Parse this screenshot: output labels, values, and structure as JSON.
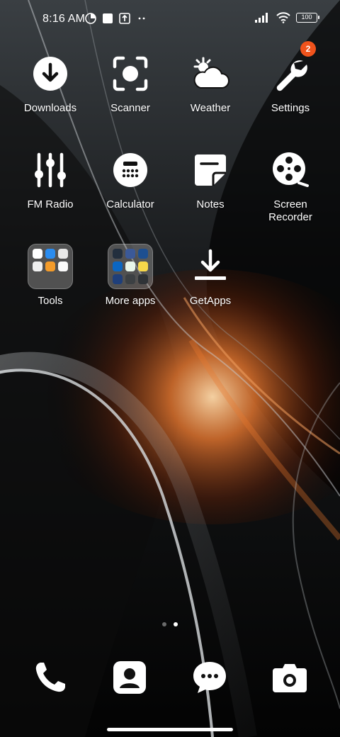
{
  "status_bar": {
    "time": "8:16 AM",
    "battery": "100",
    "icons_left": [
      "data-saver-icon",
      "square-notification-icon",
      "upload-notification-icon",
      "more-dots-icon"
    ],
    "icons_right": [
      "signal-icon",
      "wifi-icon",
      "battery-icon"
    ]
  },
  "apps": [
    {
      "label": "Downloads",
      "icon": "download-icon"
    },
    {
      "label": "Scanner",
      "icon": "scanner-icon"
    },
    {
      "label": "Weather",
      "icon": "weather-icon"
    },
    {
      "label": "Settings",
      "icon": "wrench-icon",
      "badge": "2"
    },
    {
      "label": "FM Radio",
      "icon": "sliders-icon"
    },
    {
      "label": "Calculator",
      "icon": "calculator-icon"
    },
    {
      "label": "Notes",
      "icon": "notes-icon"
    },
    {
      "label": "Screen\nRecorder",
      "icon": "film-reel-icon"
    },
    {
      "label": "Tools",
      "icon": "folder-icon"
    },
    {
      "label": "More apps",
      "icon": "folder-icon"
    },
    {
      "label": "GetApps",
      "icon": "getapps-icon"
    }
  ],
  "dock": [
    {
      "name": "phone",
      "icon": "phone-icon"
    },
    {
      "name": "contacts",
      "icon": "contacts-icon"
    },
    {
      "name": "messages",
      "icon": "messages-icon"
    },
    {
      "name": "camera",
      "icon": "camera-icon"
    }
  ],
  "pages": {
    "count": 2,
    "active": 2
  },
  "colors": {
    "badge": "#f0531c",
    "accent_orange": "#e06a2a"
  }
}
